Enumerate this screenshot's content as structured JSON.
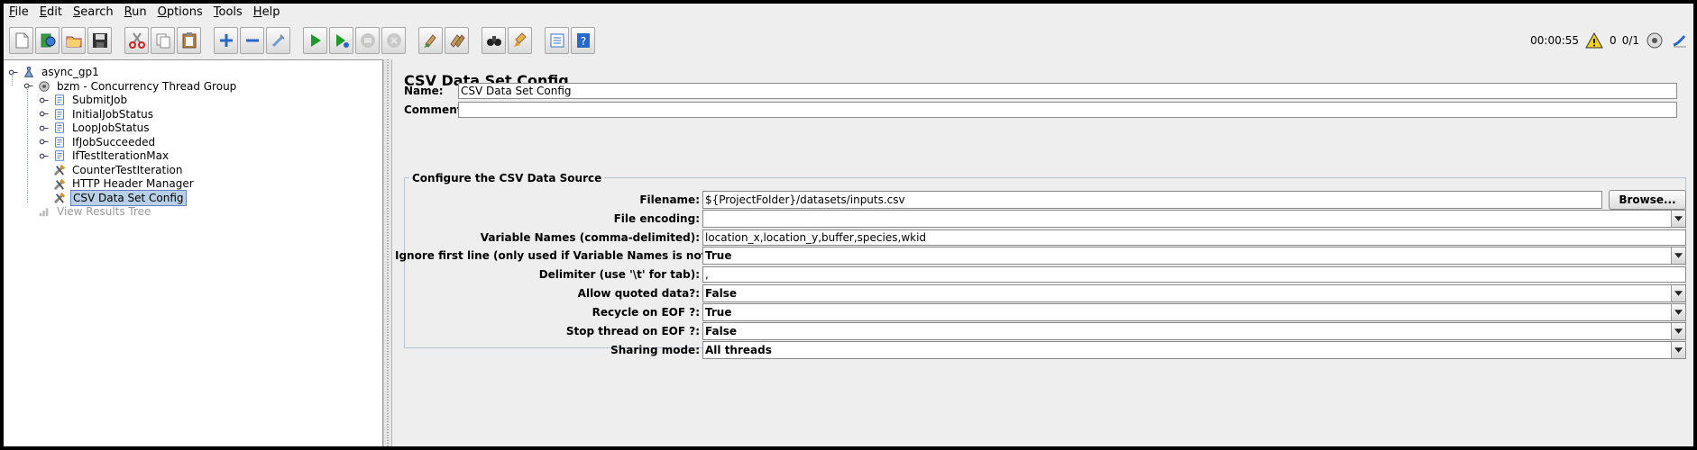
{
  "menu": [
    "File",
    "Edit",
    "Search",
    "Run",
    "Options",
    "Tools",
    "Help"
  ],
  "toolbar": {
    "groups": [
      [
        "new-icon",
        "templates-icon",
        "open-icon",
        "save-icon"
      ],
      [
        "cut-icon",
        "copy-icon",
        "paste-icon"
      ],
      [
        "expand-icon",
        "collapse-icon",
        "toggle-icon"
      ],
      [
        "start-icon",
        "start-no-pauses-icon",
        "stop-icon",
        "shutdown-icon"
      ],
      [
        "clear-icon",
        "clear-all-icon"
      ],
      [
        "search-icon",
        "reset-search-icon"
      ],
      [
        "function-helper-icon",
        "help-icon"
      ]
    ]
  },
  "status": {
    "elapsed": "00:00:55",
    "warnings": "0",
    "threads": "0/1"
  },
  "tree": [
    {
      "label": "async_gp1",
      "indent": 0,
      "icon": "test-plan-icon",
      "handle": true,
      "selected": false,
      "disabled": false
    },
    {
      "label": "bzm - Concurrency Thread Group",
      "indent": 1,
      "icon": "thread-group-icon",
      "handle": true,
      "selected": false,
      "disabled": false
    },
    {
      "label": "SubmitJob",
      "indent": 2,
      "icon": "sampler-icon",
      "handle": true,
      "selected": false,
      "disabled": false
    },
    {
      "label": "InitialJobStatus",
      "indent": 2,
      "icon": "sampler-icon",
      "handle": true,
      "selected": false,
      "disabled": false
    },
    {
      "label": "LoopJobStatus",
      "indent": 2,
      "icon": "sampler-icon",
      "handle": true,
      "selected": false,
      "disabled": false
    },
    {
      "label": "IfJobSucceeded",
      "indent": 2,
      "icon": "sampler-icon",
      "handle": true,
      "selected": false,
      "disabled": false
    },
    {
      "label": "IfTestIterationMax",
      "indent": 2,
      "icon": "sampler-icon",
      "handle": true,
      "selected": false,
      "disabled": false
    },
    {
      "label": "CounterTestIteration",
      "indent": 2,
      "icon": "config-element-icon",
      "handle": false,
      "selected": false,
      "disabled": false
    },
    {
      "label": "HTTP Header Manager",
      "indent": 2,
      "icon": "config-element-icon",
      "handle": false,
      "selected": false,
      "disabled": false
    },
    {
      "label": "CSV Data Set Config",
      "indent": 2,
      "icon": "config-element-icon",
      "handle": false,
      "selected": true,
      "disabled": false
    },
    {
      "label": "View Results Tree",
      "indent": 1,
      "icon": "listener-icon",
      "handle": false,
      "selected": false,
      "disabled": true
    }
  ],
  "panel": {
    "title": "CSV Data Set Config",
    "name_label": "Name:",
    "name_value": "CSV Data Set Config",
    "comments_label": "Comments:",
    "comments_value": "",
    "section_title": "Configure the CSV Data Source",
    "filename_label": "Filename:",
    "filename_value": "${ProjectFolder}/datasets/inputs.csv",
    "browse_label": "Browse...",
    "encoding_label": "File encoding:",
    "encoding_value": "",
    "varnames_label": "Variable Names (comma-delimited):",
    "varnames_value": "location_x,location_y,buffer,species,wkid",
    "ignore_label": "Ignore first line (only used if Variable Names is not empty):",
    "ignore_value": "True",
    "delimiter_label": "Delimiter (use '\\t' for tab):",
    "delimiter_value": ",",
    "quoted_label": "Allow quoted data?:",
    "quoted_value": "False",
    "recycle_label": "Recycle on EOF ?:",
    "recycle_value": "True",
    "stop_label": "Stop thread on EOF ?:",
    "stop_value": "False",
    "sharing_label": "Sharing mode:",
    "sharing_value": "All threads"
  }
}
